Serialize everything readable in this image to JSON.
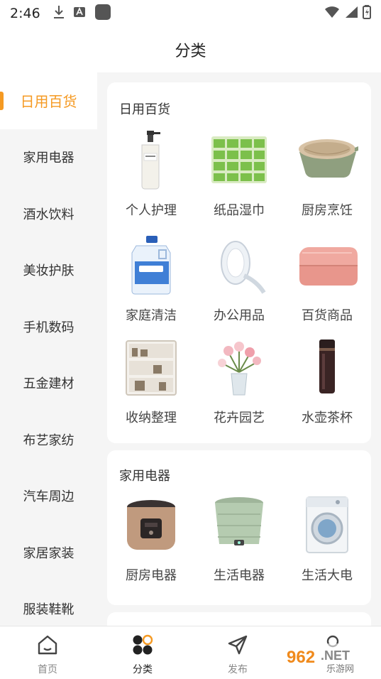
{
  "status_bar": {
    "time": "2:46"
  },
  "header": {
    "title": "分类"
  },
  "sidebar": {
    "items": [
      {
        "label": "日用百货"
      },
      {
        "label": "家用电器"
      },
      {
        "label": "酒水饮料"
      },
      {
        "label": "美妆护肤"
      },
      {
        "label": "手机数码"
      },
      {
        "label": "五金建材"
      },
      {
        "label": "布艺家纺"
      },
      {
        "label": "汽车周边"
      },
      {
        "label": "家居家装"
      },
      {
        "label": "服装鞋靴"
      }
    ],
    "active_index": 0
  },
  "sections": [
    {
      "title": "日用百货",
      "items": [
        {
          "label": "个人护理",
          "image": "pump-bottle"
        },
        {
          "label": "纸品湿巾",
          "image": "tissue-packs"
        },
        {
          "label": "厨房烹饪",
          "image": "colander-bowl"
        },
        {
          "label": "家庭清洁",
          "image": "detergent-bottle"
        },
        {
          "label": "办公用品",
          "image": "tape-roll"
        },
        {
          "label": "百货商品",
          "image": "folded-towel"
        },
        {
          "label": "收纳整理",
          "image": "storage-cabinet"
        },
        {
          "label": "花卉园艺",
          "image": "flower-vase"
        },
        {
          "label": "水壶茶杯",
          "image": "thermos-cup"
        }
      ]
    },
    {
      "title": "家用电器",
      "items": [
        {
          "label": "厨房电器",
          "image": "rice-cooker"
        },
        {
          "label": "生活电器",
          "image": "folding-washer"
        },
        {
          "label": "生活大电",
          "image": "washing-machine"
        }
      ]
    }
  ],
  "bottom_nav": [
    {
      "label": "首页",
      "icon": "home-icon"
    },
    {
      "label": "分类",
      "icon": "category-icon",
      "active": true
    },
    {
      "label": "发布",
      "icon": "send-icon"
    },
    {
      "label": "",
      "icon": "user-icon"
    }
  ],
  "watermark": {
    "text": "962.NET",
    "subtext": "乐游网"
  },
  "colors": {
    "accent": "#f59a23",
    "background": "#f5f5f5",
    "card": "#ffffff"
  }
}
